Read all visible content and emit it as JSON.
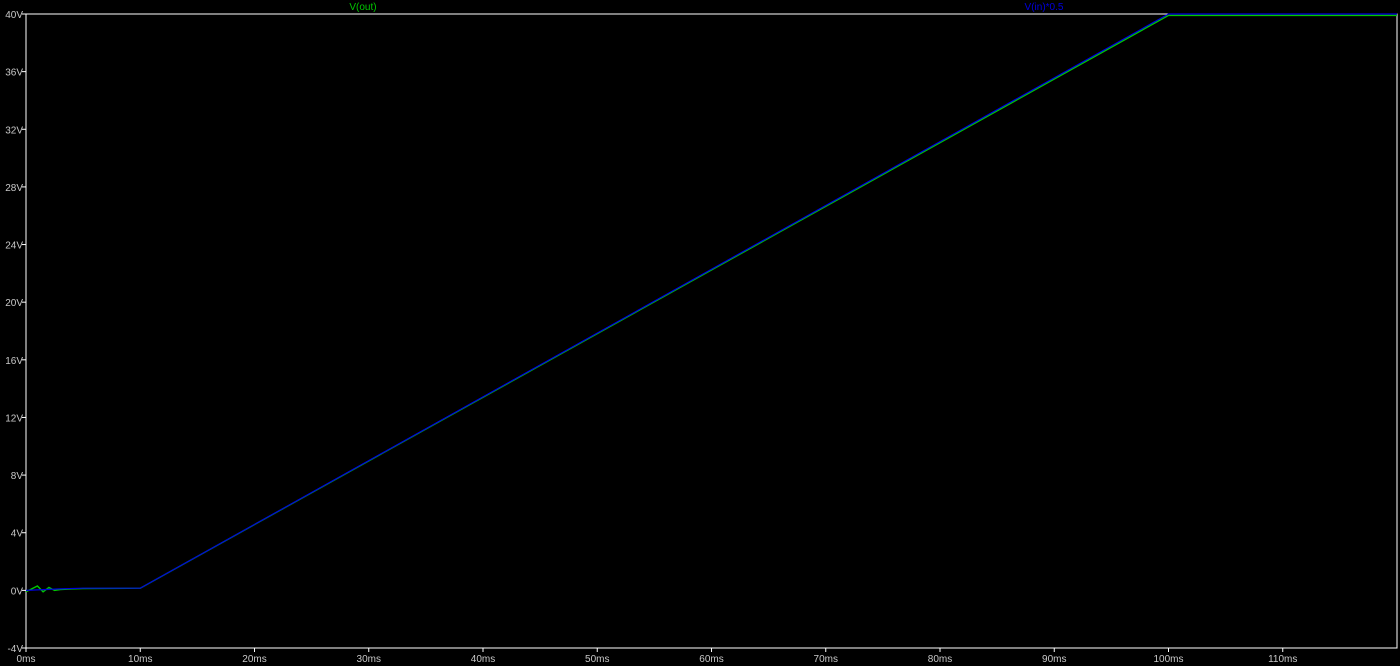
{
  "chart_data": {
    "type": "line",
    "title": "",
    "xlabel": "",
    "ylabel": "",
    "xlim": [
      0,
      120
    ],
    "ylim": [
      -4,
      40
    ],
    "x_ticks": [
      {
        "value": 0,
        "label": "0ms"
      },
      {
        "value": 10,
        "label": "10ms"
      },
      {
        "value": 20,
        "label": "20ms"
      },
      {
        "value": 30,
        "label": "30ms"
      },
      {
        "value": 40,
        "label": "40ms"
      },
      {
        "value": 50,
        "label": "50ms"
      },
      {
        "value": 60,
        "label": "60ms"
      },
      {
        "value": 70,
        "label": "70ms"
      },
      {
        "value": 80,
        "label": "80ms"
      },
      {
        "value": 90,
        "label": "90ms"
      },
      {
        "value": 100,
        "label": "100ms"
      },
      {
        "value": 110,
        "label": "110ms"
      }
    ],
    "y_ticks": [
      {
        "value": 40,
        "label": "40V"
      },
      {
        "value": 36,
        "label": "36V"
      },
      {
        "value": 32,
        "label": "32V"
      },
      {
        "value": 28,
        "label": "28V"
      },
      {
        "value": 24,
        "label": "24V"
      },
      {
        "value": 20,
        "label": "20V"
      },
      {
        "value": 16,
        "label": "16V"
      },
      {
        "value": 12,
        "label": "12V"
      },
      {
        "value": 8,
        "label": "8V"
      },
      {
        "value": 4,
        "label": "4V"
      },
      {
        "value": 0,
        "label": "0V"
      },
      {
        "value": -4,
        "label": "-4V"
      }
    ],
    "grid": false,
    "series": [
      {
        "name": "V(out)",
        "color": "#00c800",
        "x": [
          0,
          0.5,
          1,
          1.5,
          2,
          2.5,
          3,
          4,
          5,
          10,
          100,
          120
        ],
        "y": [
          -0.1,
          0.1,
          0.3,
          -0.1,
          0.2,
          0,
          0.05,
          0.1,
          0.12,
          0.15,
          39.9,
          39.9
        ]
      },
      {
        "name": "V(in)*0.5",
        "color": "#0000e0",
        "x": [
          0,
          3,
          5,
          10,
          100,
          120
        ],
        "y": [
          0,
          0.1,
          0.15,
          0.15,
          40,
          40
        ]
      }
    ]
  },
  "colors": {
    "background": "#000000",
    "frame": "#ffffff",
    "tick_text": "#c8c8c8"
  }
}
